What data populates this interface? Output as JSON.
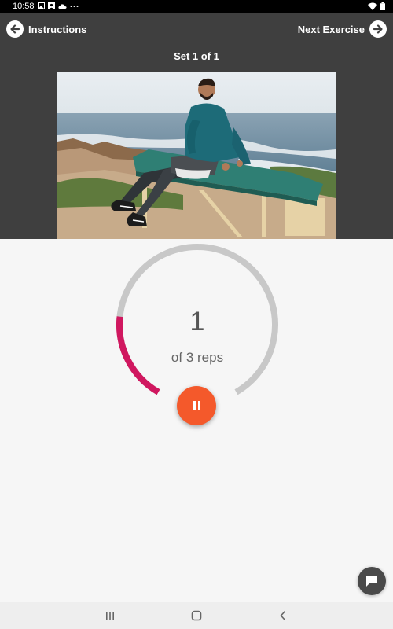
{
  "status_bar": {
    "time": "10:58",
    "left_icons": [
      "image-icon",
      "person-icon",
      "cloud-icon",
      "more-dots-icon"
    ],
    "right_icons": [
      "wifi-icon",
      "battery-icon"
    ]
  },
  "header": {
    "back_label": "Instructions",
    "next_label": "Next Exercise",
    "set_label": "Set 1 of 1"
  },
  "exercise": {
    "video_description_icon": "exercise-video",
    "current_rep": "1",
    "reps_label": "of 3 reps",
    "progress_fraction": 0.22
  },
  "colors": {
    "header_bg": "#3f3f3f",
    "progress_active": "#d0175f",
    "progress_track": "#c8c8c8",
    "pause_button": "#f4592b",
    "chat_button": "#4a4a4a"
  },
  "icons": {
    "back": "arrow-left-circle-icon",
    "next": "arrow-right-circle-icon",
    "pause": "pause-icon",
    "chat": "chat-bubble-icon",
    "android_recents": "recents-icon",
    "android_home": "home-icon",
    "android_back": "back-icon"
  }
}
